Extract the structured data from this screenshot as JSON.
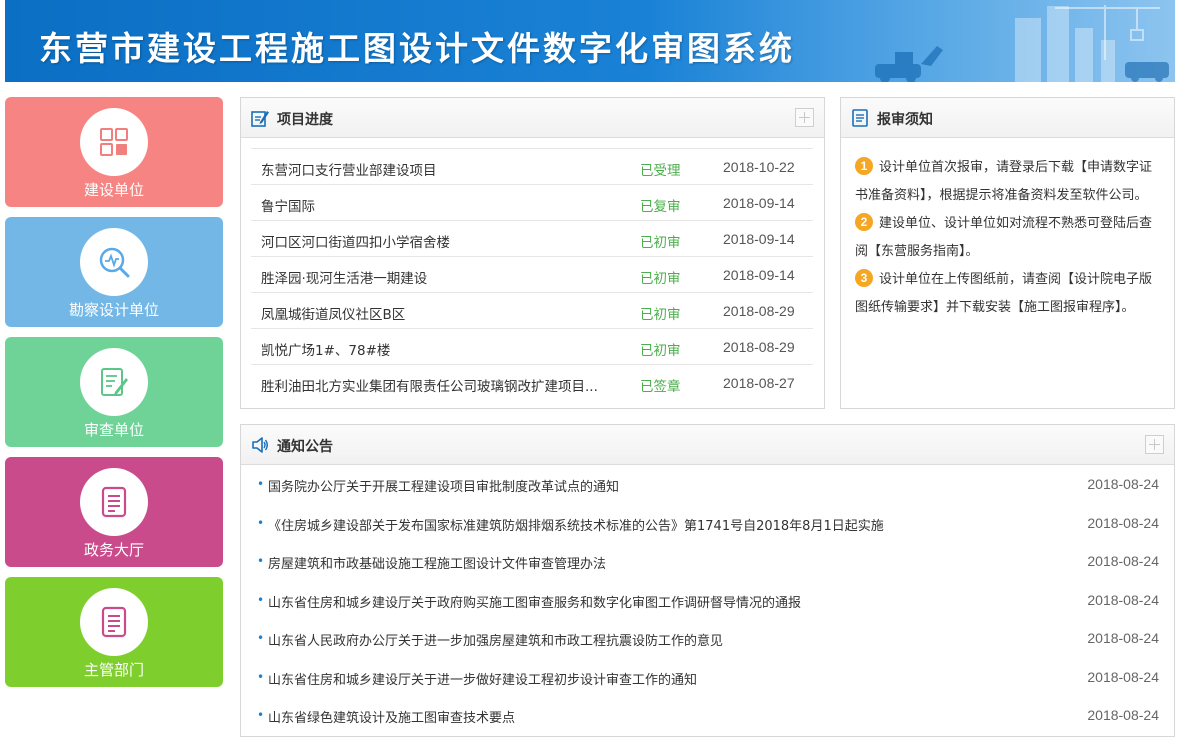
{
  "header": {
    "title": "东营市建设工程施工图设计文件数字化审图系统",
    "background_color": "#1a82d6"
  },
  "tiles": [
    {
      "label": "建设单位",
      "color": "#f58482",
      "icon": "grid-icon",
      "icon_color": "#f07f7d"
    },
    {
      "label": "勘察设计单位",
      "color": "#72b7e6",
      "icon": "survey-search-icon",
      "icon_color": "#5aa9e6"
    },
    {
      "label": "审查单位",
      "color": "#6fd398",
      "icon": "review-pen-icon",
      "icon_color": "#5cc588"
    },
    {
      "label": "政务大厅",
      "color": "#c94b8c",
      "icon": "document-icon",
      "icon_color": "#c94b8c"
    },
    {
      "label": "主管部门",
      "color": "#7ecf2e",
      "icon": "document-icon",
      "icon_color": "#c94b8c"
    }
  ],
  "project_panel": {
    "title": "项目进度",
    "icon": "edit-icon",
    "rows": [
      {
        "name": "东营河口支行营业部建设项目",
        "status": "已受理",
        "date": "2018-10-22"
      },
      {
        "name": "鲁宁国际",
        "status": "已复审",
        "date": "2018-09-14"
      },
      {
        "name": "河口区河口街道四扣小学宿舍楼",
        "status": "已初审",
        "date": "2018-09-14"
      },
      {
        "name": "胜泽园·现河生活港一期建设",
        "status": "已初审",
        "date": "2018-09-14"
      },
      {
        "name": "凤凰城街道凤仪社区B区",
        "status": "已初审",
        "date": "2018-08-29"
      },
      {
        "name": "凯悦广场1#、78#楼",
        "status": "已初审",
        "date": "2018-08-29"
      },
      {
        "name": "胜利油田北方实业集团有限责任公司玻璃钢改扩建项目...",
        "status": "已签章",
        "date": "2018-08-27"
      }
    ]
  },
  "notice_panel": {
    "title": "报审须知",
    "icon": "list-icon",
    "items": [
      {
        "num": "1",
        "text": "设计单位首次报审，请登录后下载【申请数字证书准备资料】，根据提示将准备资料发至软件公司。"
      },
      {
        "num": "2",
        "text": "建设单位、设计单位如对流程不熟悉可登陆后查阅【东营服务指南】。"
      },
      {
        "num": "3",
        "text": "设计单位在上传图纸前，请查阅【设计院电子版图纸传输要求】并下载安装【施工图报审程序】。"
      }
    ]
  },
  "announce_panel": {
    "title": "通知公告",
    "icon": "speaker-icon",
    "rows": [
      {
        "title": "国务院办公厅关于开展工程建设项目审批制度改革试点的通知",
        "date": "2018-08-24"
      },
      {
        "title": "《住房城乡建设部关于发布国家标准建筑防烟排烟系统技术标准的公告》第1741号自2018年8月1日起实施",
        "date": "2018-08-24"
      },
      {
        "title": "房屋建筑和市政基础设施工程施工图设计文件审查管理办法",
        "date": "2018-08-24"
      },
      {
        "title": "山东省住房和城乡建设厅关于政府购买施工图审查服务和数字化审图工作调研督导情况的通报",
        "date": "2018-08-24"
      },
      {
        "title": "山东省人民政府办公厅关于进一步加强房屋建筑和市政工程抗震设防工作的意见",
        "date": "2018-08-24"
      },
      {
        "title": "山东省住房和城乡建设厅关于进一步做好建设工程初步设计审查工作的通知",
        "date": "2018-08-24"
      },
      {
        "title": "山东省绿色建筑设计及施工图审查技术要点",
        "date": "2018-08-24"
      }
    ]
  }
}
